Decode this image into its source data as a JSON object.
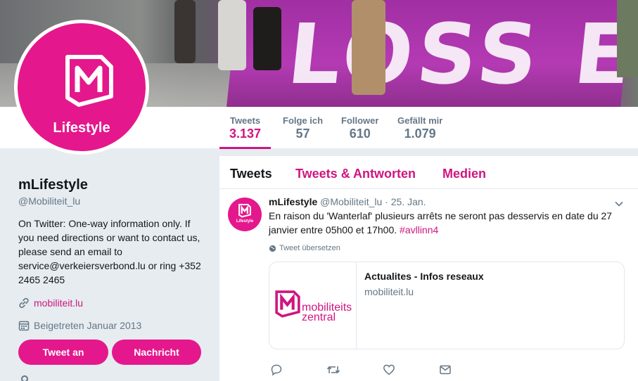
{
  "colors": {
    "accent": "#e5178c",
    "link": "#cf1580",
    "muted": "#657786"
  },
  "banner": {
    "text": "LOSS ET"
  },
  "avatar": {
    "text": "Lifestyle"
  },
  "stats": [
    {
      "label": "Tweets",
      "value": "3.137"
    },
    {
      "label": "Folge ich",
      "value": "57"
    },
    {
      "label": "Follower",
      "value": "610"
    },
    {
      "label": "Gefällt mir",
      "value": "1.079"
    }
  ],
  "profile": {
    "name": "mLifestyle",
    "handle": "@Mobiliteit_lu",
    "bio": "On Twitter: One-way information only. If you need directions or want to contact us, please send an email to service@verkeiersverbond.lu or ring +352 2465 2465",
    "website": "mobiliteit.lu",
    "joined": "Beigetreten Januar 2013",
    "tweet_button": "Tweet an",
    "message_button": "Nachricht"
  },
  "tabs": [
    {
      "label": "Tweets"
    },
    {
      "label": "Tweets & Antworten"
    },
    {
      "label": "Medien"
    }
  ],
  "tweet": {
    "avatar_text": "Lifestyle",
    "name": "mLifestyle",
    "handle": "@Mobiliteit_lu",
    "date": "· 25. Jan.",
    "text": "En raison du 'Wanterlaf' plusieurs arrêts ne seront pas desservis en date du 27 janvier entre 05h00 et 17h00.",
    "hashtag": "#avllinn4",
    "translate": "Tweet übersetzen",
    "card": {
      "logo_text_1": "mobiliteits",
      "logo_text_2": "zentral",
      "title": "Actualites - Infos reseaux",
      "domain": "mobiliteit.lu"
    }
  }
}
